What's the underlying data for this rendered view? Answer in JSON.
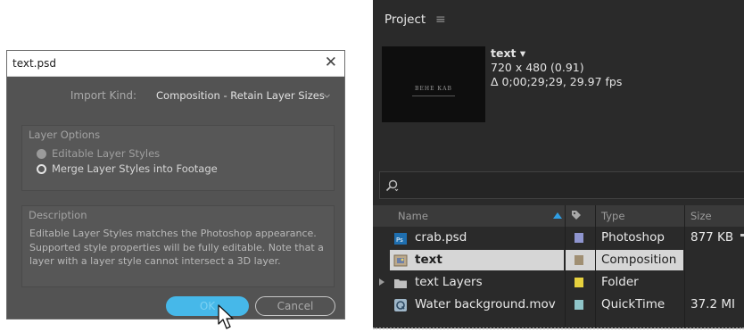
{
  "dialog": {
    "title": "text.psd",
    "close_glyph": "✕",
    "import_kind_label": "Import Kind:",
    "import_kind_value": "Composition - Retain Layer Sizes",
    "layer_options": {
      "title": "Layer Options",
      "options": [
        {
          "label": "Editable Layer Styles",
          "selected": false
        },
        {
          "label": "Merge Layer Styles into Footage",
          "selected": true
        }
      ]
    },
    "description": {
      "title": "Description",
      "text": "Editable Layer Styles matches the Photoshop appearance. Supported style properties will be fully editable. Note that a layer with a layer style cannot intersect a 3D layer."
    },
    "ok_label": "OK",
    "cancel_label": "Cancel"
  },
  "project": {
    "title": "Project",
    "menu_glyph": "≡",
    "preview": {
      "thumb_text": "ВЕНЕ КАВ",
      "name": "text ▾",
      "dimensions": "720 x 480 (0.91)",
      "duration": "Δ 0;00;29;29, 29.97 fps"
    },
    "search_icon": "search-icon",
    "columns": {
      "name": "Name",
      "type": "Type",
      "size": "Size"
    },
    "rows": [
      {
        "icon": "photoshop-icon",
        "name": "crab.psd",
        "label_color": "#8f95cf",
        "type": "Photoshop",
        "size": "877 KB",
        "selected": false
      },
      {
        "icon": "composition-icon",
        "name": "text",
        "label_color": "#a08f73",
        "type": "Composition",
        "size": "",
        "selected": true
      },
      {
        "icon": "folder-icon",
        "name": "text Layers",
        "label_color": "#e6d13e",
        "type": "Folder",
        "size": "",
        "selected": false
      },
      {
        "icon": "quicktime-icon",
        "name": "Water background.mov",
        "label_color": "#8fc4c8",
        "type": "QuickTime",
        "size": "37.2 MI",
        "selected": false
      }
    ]
  },
  "colors": {
    "dialog_bg": "#535353",
    "ok_button": "#46b8e9",
    "panel_bg": "#2a2a2a",
    "selected_row": "#d6d6d6"
  }
}
